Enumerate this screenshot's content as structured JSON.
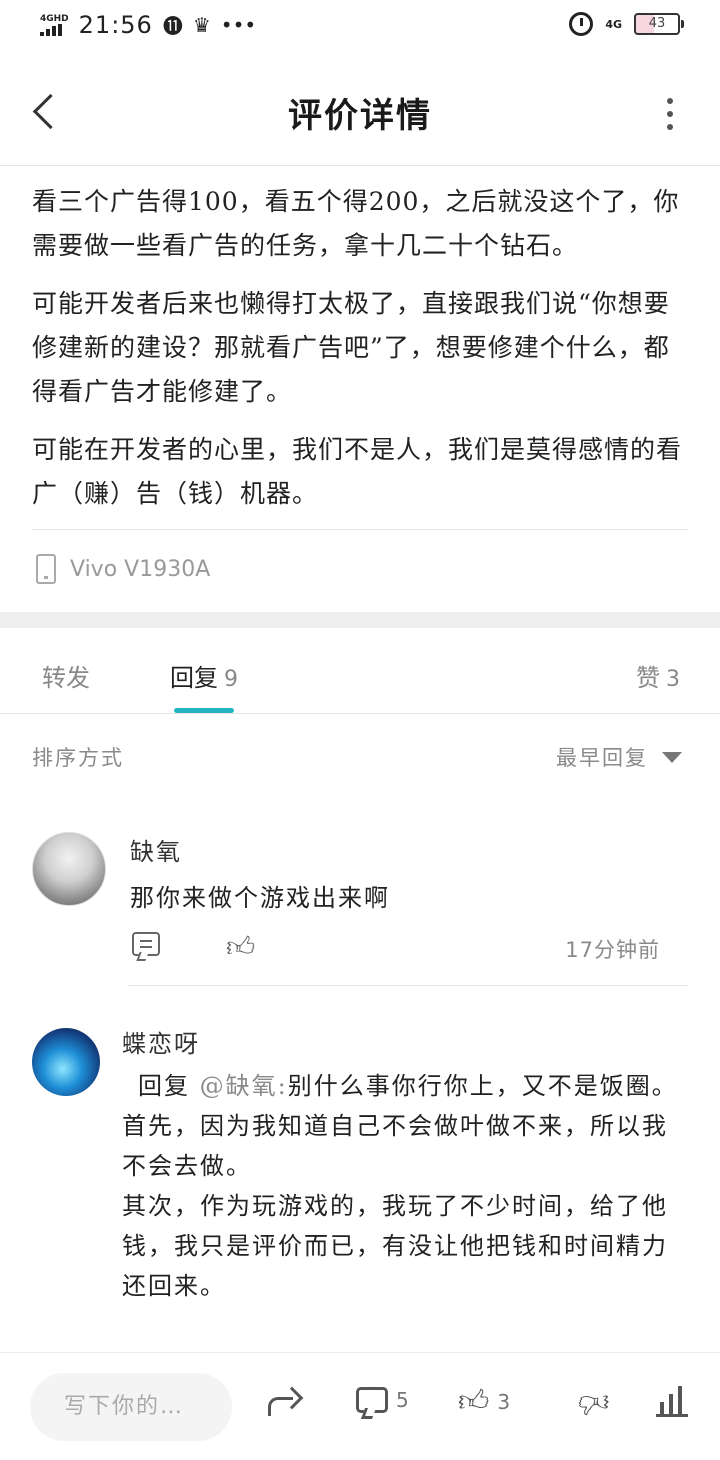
{
  "status_bar": {
    "network": "4GHD",
    "time": "21:56",
    "icons": [
      "signal-icon",
      "hdr-icon",
      "crown-icon",
      "more-dots-icon",
      "alarm-icon",
      "4g-icon",
      "battery-icon"
    ],
    "net_right": "4G",
    "battery": "43"
  },
  "header": {
    "title": "评价详情"
  },
  "review": {
    "paragraphs": [
      "看三个广告得100，看五个得200，之后就没这个了，你需要做一些看广告的任务，拿十几二十个钻石。",
      "可能开发者后来也懒得打太极了，直接跟我们说“你想要修建新的建设？那就看广告吧”了，想要修建个什么，都得看广告才能修建了。",
      "可能在开发者的心里，我们不是人，我们是莫得感情的看广（赚）告（钱）机器。"
    ],
    "device": "Vivo V1930A"
  },
  "tabs": {
    "forward": "转发",
    "reply": "回复",
    "reply_count": "9",
    "like": "赞",
    "like_count": "3"
  },
  "sort": {
    "label": "排序方式",
    "value": "最早回复"
  },
  "comments": [
    {
      "name": "缺氧",
      "text": "那你来做个游戏出来啊",
      "time": "17分钟前"
    },
    {
      "name": "蝶恋呀",
      "reply_prefix": "回复",
      "mention": "@缺氧:",
      "lines": [
        "别什么事你行你上，又不是饭圈。",
        "首先，因为我知道自己不会做叶做不来，所以我不会去做。",
        "其次，作为玩游戏的，我玩了不少时间，给了他钱，我只是评价而已，有没让他把钱和时间精力还回来。"
      ]
    }
  ],
  "bottom_bar": {
    "input_placeholder": "写下你的…",
    "comment_count": "5",
    "like_count": "3"
  },
  "colors": {
    "accent": "#22b5c2"
  }
}
